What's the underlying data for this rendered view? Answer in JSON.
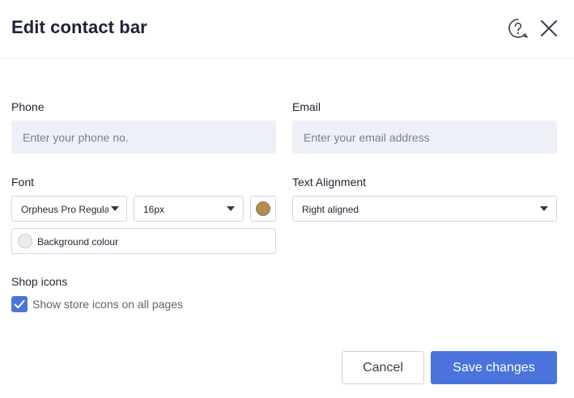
{
  "dialog": {
    "title": "Edit contact bar"
  },
  "phone": {
    "label": "Phone",
    "value": "",
    "placeholder": "Enter your phone no."
  },
  "email": {
    "label": "Email",
    "value": "",
    "placeholder": "Enter your email address"
  },
  "font": {
    "label": "Font",
    "family_value": "Orpheus Pro Regular",
    "size_value": "16px",
    "text_color": "#b08d50"
  },
  "alignment": {
    "label": "Text Alignment",
    "value": "Right aligned"
  },
  "background": {
    "label": "Background colour",
    "color": "#ececec"
  },
  "shop_icons": {
    "label": "Shop icons",
    "checkbox_label": "Show store icons on all pages",
    "checked": true
  },
  "actions": {
    "cancel_label": "Cancel",
    "save_label": "Save changes",
    "accent_color": "#4a74dc"
  },
  "icons": {
    "help": "help-icon",
    "close": "close-icon",
    "caret": "chevron-down-icon",
    "check": "checkmark-icon"
  }
}
